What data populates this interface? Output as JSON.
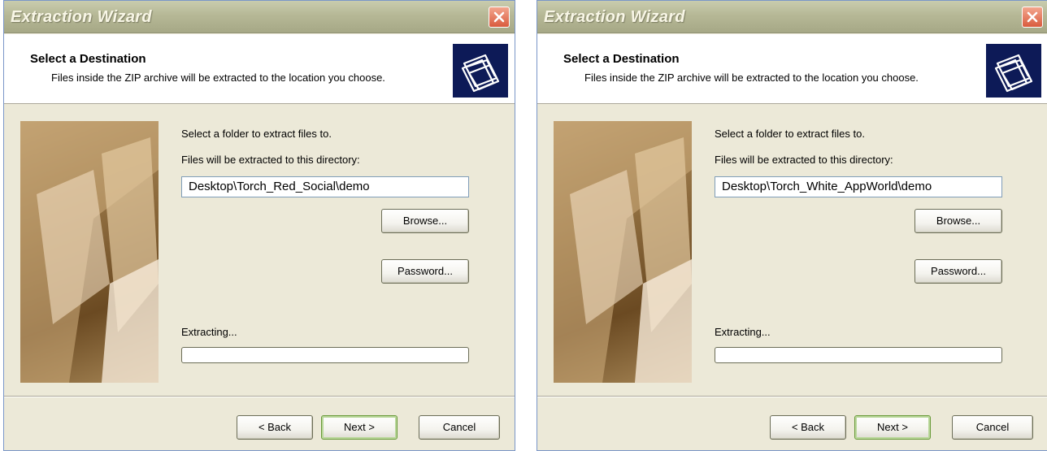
{
  "windows": [
    {
      "title": "Extraction Wizard",
      "header": {
        "title": "Select a Destination",
        "subtitle": "Files inside the ZIP archive will be extracted to the location you choose."
      },
      "select_label": "Select a folder to extract files to.",
      "dir_label": "Files will be extracted to this directory:",
      "directory": "Desktop\\Torch_Red_Social\\demo",
      "browse_label": "Browse...",
      "password_label": "Password...",
      "extracting_label": "Extracting...",
      "progress": 0,
      "back_label": "< Back",
      "next_label": "Next >",
      "cancel_label": "Cancel"
    },
    {
      "title": "Extraction Wizard",
      "header": {
        "title": "Select a Destination",
        "subtitle": "Files inside the ZIP archive will be extracted to the location you choose."
      },
      "select_label": "Select a folder to extract files to.",
      "dir_label": "Files will be extracted to this directory:",
      "directory": "Desktop\\Torch_White_AppWorld\\demo",
      "browse_label": "Browse...",
      "password_label": "Password...",
      "extracting_label": "Extracting...",
      "progress": 0,
      "back_label": "< Back",
      "next_label": "Next >",
      "cancel_label": "Cancel"
    }
  ],
  "colors": {
    "dialog_background": "#ece9d8",
    "title_text": "#f8f6e6",
    "close_button": "#d95b3e",
    "header_icon_background": "#0d1a57"
  },
  "icons": [
    "close-icon",
    "folders-icon"
  ]
}
